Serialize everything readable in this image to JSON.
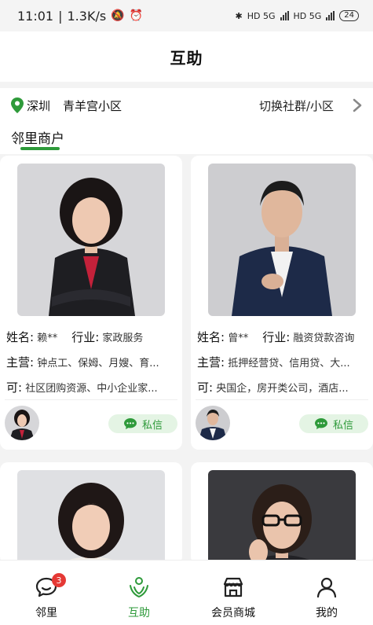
{
  "status_bar": {
    "time": "11:01",
    "speed": "1.3K/s",
    "net1": "HD 5G",
    "net2": "HD 5G",
    "battery": "24"
  },
  "header": {
    "title": "互助"
  },
  "location": {
    "city": "深圳",
    "community": "青羊宫小区",
    "switch_label": "切换社群/小区"
  },
  "section_tab": {
    "label": "邻里商户"
  },
  "labels": {
    "name": "姓名:",
    "industry": "行业:",
    "main": "主营:",
    "can": "可:",
    "message": "私信"
  },
  "merchants": [
    {
      "name": "赖**",
      "industry": "家政服务",
      "main_business": "钟点工、保姆、月嫂、育...",
      "can_offer": "社区团购资源、中小企业家..."
    },
    {
      "name": "曾**",
      "industry": "融资贷款咨询",
      "main_business": "抵押经营贷、信用贷、大...",
      "can_offer": "央国企，房开类公司，酒店..."
    }
  ],
  "tabbar": [
    {
      "label": "邻里",
      "badge": "3"
    },
    {
      "label": "互助"
    },
    {
      "label": "会员商城"
    },
    {
      "label": "我的"
    }
  ],
  "colors": {
    "accent": "#2e9a3a",
    "badge": "#e53935",
    "photo_bg": "#d9d9dc"
  }
}
